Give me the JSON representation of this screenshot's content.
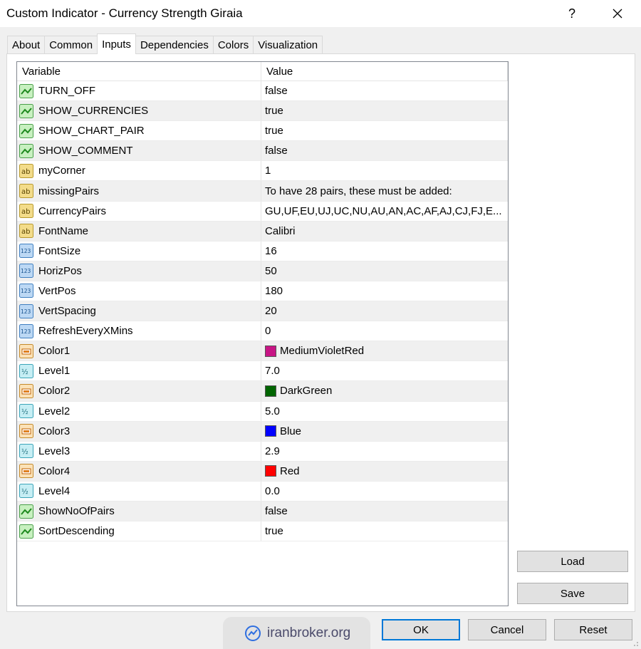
{
  "window": {
    "title": "Custom Indicator - Currency Strength Giraia",
    "help_label": "?",
    "close_label": "✕"
  },
  "tabs": [
    {
      "label": "About"
    },
    {
      "label": "Common"
    },
    {
      "label": "Inputs",
      "active": true
    },
    {
      "label": "Dependencies"
    },
    {
      "label": "Colors"
    },
    {
      "label": "Visualization"
    }
  ],
  "grid": {
    "col_variable": "Variable",
    "col_value": "Value",
    "rows": [
      {
        "icon": "bool-icon",
        "name": "TURN_OFF",
        "value": "false"
      },
      {
        "icon": "bool-icon",
        "name": "SHOW_CURRENCIES",
        "value": "true"
      },
      {
        "icon": "bool-icon",
        "name": "SHOW_CHART_PAIR",
        "value": "true"
      },
      {
        "icon": "bool-icon",
        "name": "SHOW_COMMENT",
        "value": "false"
      },
      {
        "icon": "string-icon",
        "name": "myCorner",
        "value": "1"
      },
      {
        "icon": "string-icon",
        "name": "missingPairs",
        "value": "To have 28 pairs, these must be added:"
      },
      {
        "icon": "string-icon",
        "name": "CurrencyPairs",
        "value": "GU,UF,EU,UJ,UC,NU,AU,AN,AC,AF,AJ,CJ,FJ,E..."
      },
      {
        "icon": "string-icon",
        "name": "FontName",
        "value": "Calibri"
      },
      {
        "icon": "int-icon",
        "name": "FontSize",
        "value": "16"
      },
      {
        "icon": "int-icon",
        "name": "HorizPos",
        "value": "50"
      },
      {
        "icon": "int-icon",
        "name": "VertPos",
        "value": "180"
      },
      {
        "icon": "int-icon",
        "name": "VertSpacing",
        "value": "20"
      },
      {
        "icon": "int-icon",
        "name": "RefreshEveryXMins",
        "value": "0"
      },
      {
        "icon": "color-icon",
        "name": "Color1",
        "value": "MediumVioletRed",
        "swatch": "#c71585"
      },
      {
        "icon": "double-icon",
        "name": "Level1",
        "value": "7.0"
      },
      {
        "icon": "color-icon",
        "name": "Color2",
        "value": "DarkGreen",
        "swatch": "#006400"
      },
      {
        "icon": "double-icon",
        "name": "Level2",
        "value": "5.0"
      },
      {
        "icon": "color-icon",
        "name": "Color3",
        "value": "Blue",
        "swatch": "#0000ff"
      },
      {
        "icon": "double-icon",
        "name": "Level3",
        "value": "2.9"
      },
      {
        "icon": "color-icon",
        "name": "Color4",
        "value": "Red",
        "swatch": "#ff0000"
      },
      {
        "icon": "double-icon",
        "name": "Level4",
        "value": "0.0"
      },
      {
        "icon": "bool-icon",
        "name": "ShowNoOfPairs",
        "value": "false"
      },
      {
        "icon": "bool-icon",
        "name": "SortDescending",
        "value": "true"
      }
    ]
  },
  "side_buttons": {
    "load_label": "Load",
    "save_label": "Save"
  },
  "footer": {
    "ok_label": "OK",
    "cancel_label": "Cancel",
    "reset_label": "Reset"
  },
  "watermark": {
    "text": "iranbroker.org"
  },
  "colors": {
    "ok_border": "#0078d7",
    "alt_row": "#f0f0f0"
  }
}
